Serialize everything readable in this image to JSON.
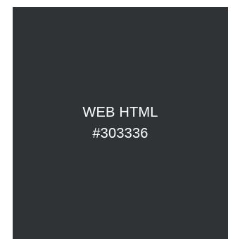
{
  "swatch": {
    "label": "WEB HTML",
    "hex": "#303336",
    "background": "#303336",
    "text_color": "#ffffff"
  }
}
